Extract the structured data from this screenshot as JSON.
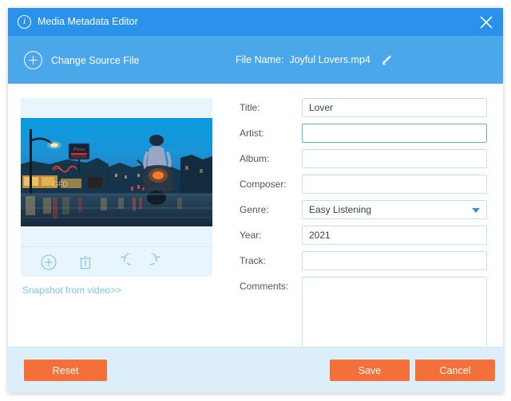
{
  "window": {
    "title": "Media Metadata Editor",
    "info_icon": "info-icon",
    "close_icon": "close-icon",
    "accent_blue": "#2b92eb",
    "header_blue": "#4aa7ea",
    "button_orange": "#f4703a",
    "footer_blue": "#ddeefb"
  },
  "header": {
    "change_source_label": "Change Source File",
    "plus_icon": "plus-circle-icon",
    "filename_label": "File Name:",
    "filename_value": "Joyful Lovers.mp4",
    "edit_icon": "edit-pencil-icon"
  },
  "thumbnail": {
    "alt": "Night city street with scooter rider",
    "tools": [
      {
        "name": "add-image-icon",
        "tooltip": "Add"
      },
      {
        "name": "delete-image-icon",
        "tooltip": "Delete"
      },
      {
        "name": "rotate-left-icon",
        "tooltip": "Rotate left"
      },
      {
        "name": "rotate-right-icon",
        "tooltip": "Rotate right"
      }
    ],
    "snapshot_link": "Snapshot from video>>"
  },
  "form": {
    "fields": [
      {
        "label": "Title:",
        "value": "Lover",
        "placeholder": "",
        "type": "text",
        "focused": false
      },
      {
        "label": "Artist:",
        "value": "",
        "placeholder": "",
        "type": "text",
        "focused": true
      },
      {
        "label": "Album:",
        "value": "",
        "placeholder": "",
        "type": "text",
        "focused": false
      },
      {
        "label": "Composer:",
        "value": "",
        "placeholder": "",
        "type": "text",
        "focused": false
      },
      {
        "label": "Genre:",
        "value": "Easy Listening",
        "placeholder": "",
        "type": "select",
        "focused": false
      },
      {
        "label": "Year:",
        "value": "2021",
        "placeholder": "",
        "type": "text",
        "focused": false
      },
      {
        "label": "Track:",
        "value": "",
        "placeholder": "",
        "type": "text",
        "focused": false
      },
      {
        "label": "Comments:",
        "value": "",
        "placeholder": "",
        "type": "textarea",
        "focused": false
      }
    ]
  },
  "footer": {
    "reset_label": "Reset",
    "save_label": "Save",
    "cancel_label": "Cancel"
  }
}
